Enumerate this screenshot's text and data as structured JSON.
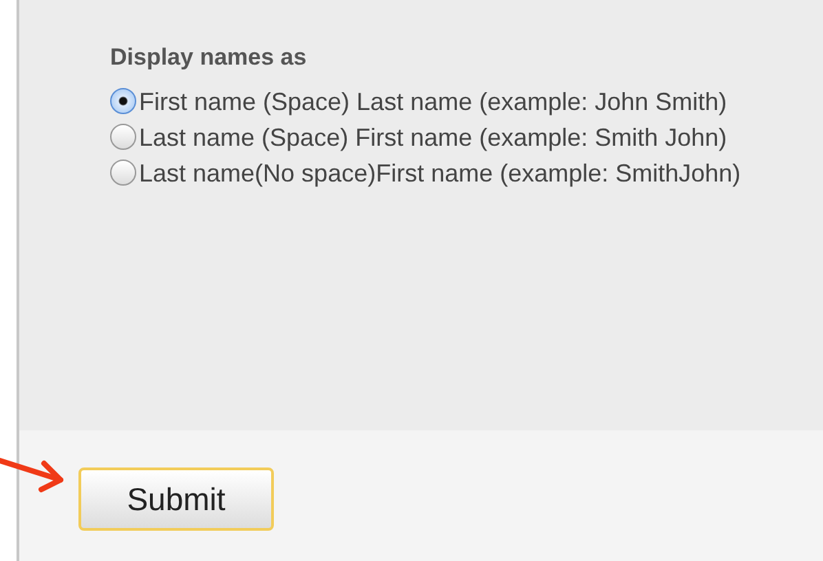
{
  "section": {
    "title": "Display names as"
  },
  "options": [
    {
      "label": "First name (Space) Last name (example: John Smith)",
      "selected": true
    },
    {
      "label": "Last name (Space) First name (example: Smith John)",
      "selected": false
    },
    {
      "label": "Last name(No space)First name (example: SmithJohn)",
      "selected": false
    }
  ],
  "buttons": [
    {
      "label": "Submit"
    }
  ]
}
